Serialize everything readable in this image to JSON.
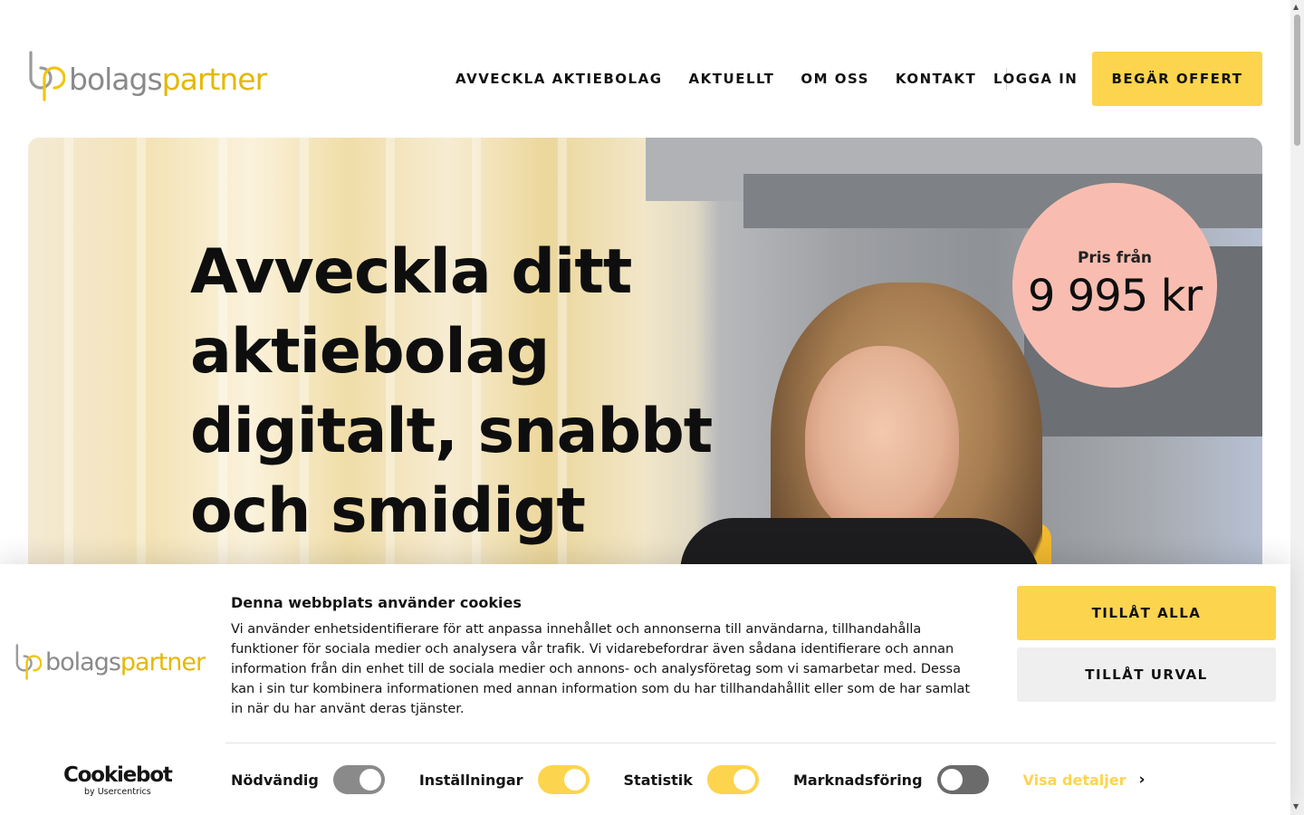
{
  "header": {
    "logo": {
      "part1": "bolags",
      "part2": "partner"
    },
    "nav": [
      "AVVECKLA AKTIEBOLAG",
      "AKTUELLT",
      "OM OSS",
      "KONTAKT"
    ],
    "login_label": "LOGGA IN",
    "offer_label": "BEGÄR OFFERT"
  },
  "hero": {
    "title": "Avveckla ditt aktiebolag digitalt, snabbt och smidigt",
    "price_label": "Pris från",
    "price_value": "9 995 kr"
  },
  "cookie_banner": {
    "title": "Denna webbplats använder cookies",
    "text": "Vi använder enhetsidentifierare för att anpassa innehållet och annonserna till användarna, tillhandahålla funktioner för sociala medier och analysera vår trafik. Vi vidarebefordrar även sådana identifierare och annan information från din enhet till de sociala medier och annons- och analysföretag som vi samarbetar med. Dessa kan i sin tur kombinera informationen med annan information som du har tillhandahållit eller som de har samlat in när du har använt deras tjänster.",
    "allow_all_label": "TILLÅT ALLA",
    "allow_selection_label": "TILLÅT URVAL",
    "cookiebot_name": "Cookiebot",
    "cookiebot_sub": "by Usercentrics",
    "toggles": [
      {
        "label": "Nödvändig",
        "checked": true,
        "disabled": true,
        "color": "#8a8a8a"
      },
      {
        "label": "Inställningar",
        "checked": true,
        "disabled": false,
        "color": "#fdd44d"
      },
      {
        "label": "Statistik",
        "checked": true,
        "disabled": false,
        "color": "#fdd44d"
      },
      {
        "label": "Marknadsföring",
        "checked": false,
        "disabled": false,
        "color": "#6b6b6b"
      }
    ],
    "details_label": "Visa detaljer"
  },
  "colors": {
    "accent": "#fdd44d",
    "price_badge": "#f8bdb0",
    "link": "#fdd44d"
  }
}
